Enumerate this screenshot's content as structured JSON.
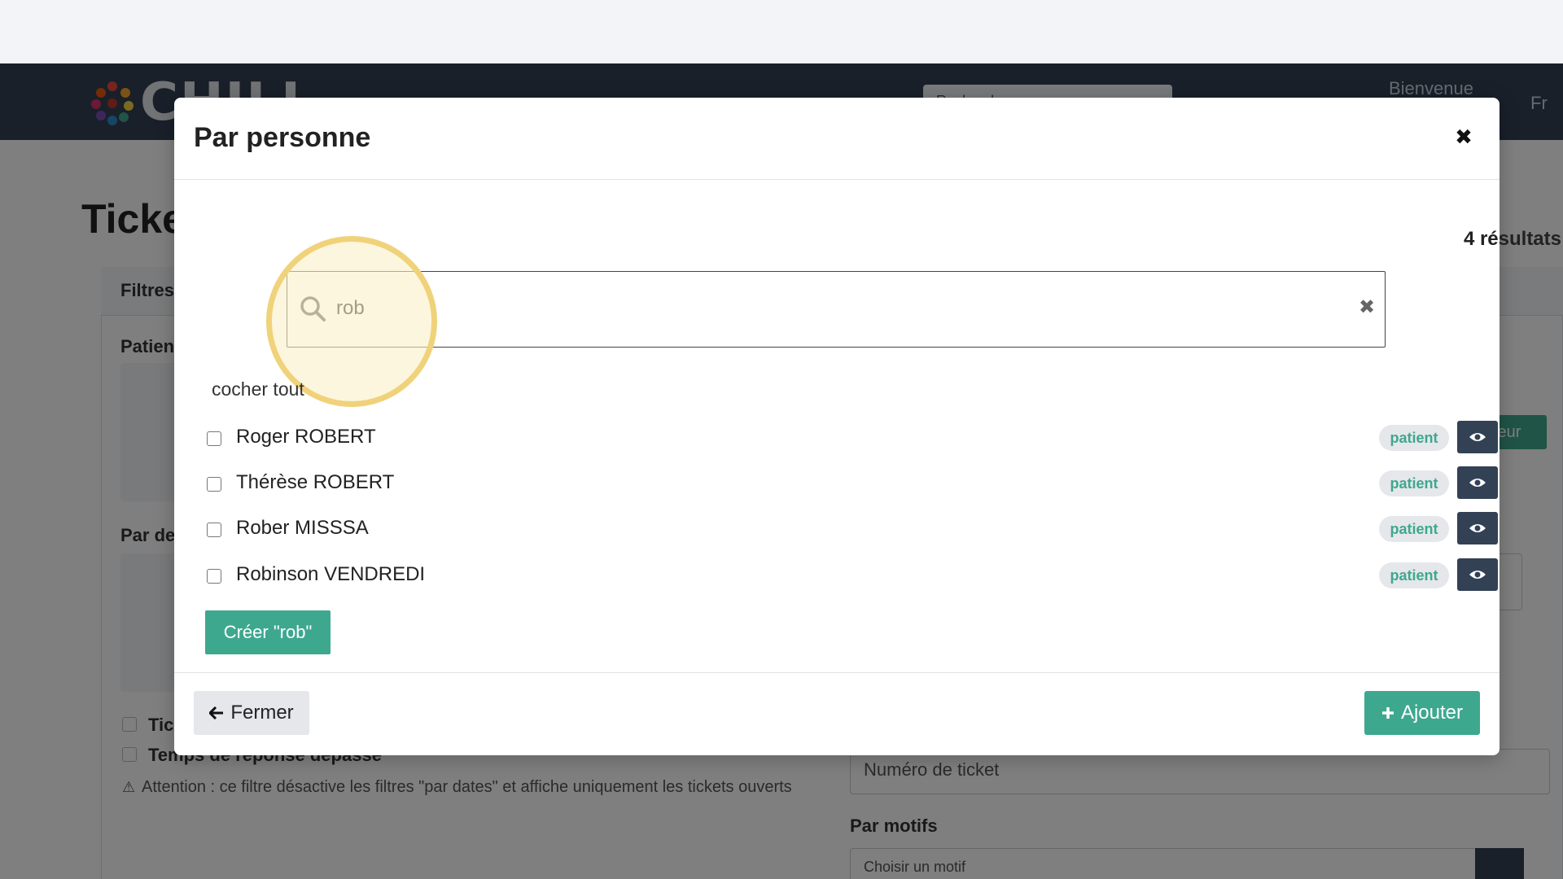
{
  "background": {
    "nav_search_placeholder": "Recherche...",
    "nav_welcome": "Bienvenue",
    "nav_lang": "Fr",
    "page_title": "Ticke",
    "filters_label": "Filtres",
    "patient_label": "Patien",
    "by_label": "Par de",
    "check_label_1": "Tic",
    "check_label_2": "Temps de réponse dépassé",
    "warning_text": "Attention : ce filtre désactive les filtres \"par dates\" et affiche uniquement les tickets ouverts",
    "ticket_number_placeholder": "Numéro de ticket",
    "motifs_label": "Par motifs",
    "motif_placeholder": "Choisir un motif",
    "green_btn_label": "teur"
  },
  "modal": {
    "title": "Par personne",
    "close_icon": "close-icon",
    "result_count": "4 résultats",
    "search": {
      "value": "rob",
      "icon": "search-icon",
      "clear_icon": "clear-icon"
    },
    "check_all_label": "cocher tout",
    "results": [
      {
        "name": "Roger ROBERT",
        "badge": "patient"
      },
      {
        "name": "Thérèse ROBERT",
        "badge": "patient"
      },
      {
        "name": "Rober MISSSA",
        "badge": "patient"
      },
      {
        "name": "Robinson VENDREDI",
        "badge": "patient"
      }
    ],
    "create_label": "Créer \"rob\"",
    "footer": {
      "close_label": "Fermer",
      "add_label": "Ajouter"
    }
  },
  "colors": {
    "accent": "#3ea88f",
    "dark": "#334155",
    "highlight": "#f0d27a"
  }
}
